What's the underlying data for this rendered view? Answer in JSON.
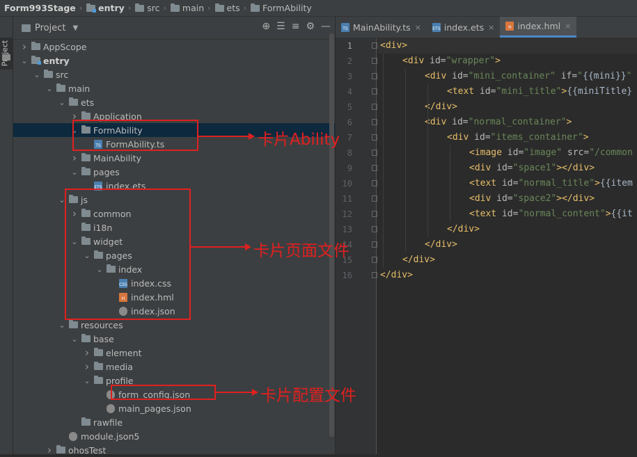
{
  "breadcrumb": [
    "Form993Stage",
    "entry",
    "src",
    "main",
    "ets",
    "FormAbility"
  ],
  "side_tab": "Project",
  "project_header": "Project",
  "tree": [
    {
      "label": "AppScope",
      "depth": 1,
      "arrow": "right",
      "icon": "folder"
    },
    {
      "label": "entry",
      "depth": 1,
      "arrow": "down",
      "icon": "module",
      "bold": true
    },
    {
      "label": "src",
      "depth": 2,
      "arrow": "down",
      "icon": "folder"
    },
    {
      "label": "main",
      "depth": 3,
      "arrow": "down",
      "icon": "folder"
    },
    {
      "label": "ets",
      "depth": 4,
      "arrow": "down",
      "icon": "folder"
    },
    {
      "label": "Application",
      "depth": 5,
      "arrow": "right",
      "icon": "folder"
    },
    {
      "label": "FormAbility",
      "depth": 5,
      "arrow": "down",
      "icon": "folder",
      "selected": true
    },
    {
      "label": "FormAbility.ts",
      "depth": 6,
      "arrow": "",
      "icon": "ts"
    },
    {
      "label": "MainAbility",
      "depth": 5,
      "arrow": "right",
      "icon": "folder"
    },
    {
      "label": "pages",
      "depth": 5,
      "arrow": "down",
      "icon": "folder"
    },
    {
      "label": "index.ets",
      "depth": 6,
      "arrow": "",
      "icon": "ets"
    },
    {
      "label": "js",
      "depth": 4,
      "arrow": "down",
      "icon": "folder"
    },
    {
      "label": "common",
      "depth": 5,
      "arrow": "right",
      "icon": "folder"
    },
    {
      "label": "i18n",
      "depth": 5,
      "arrow": "",
      "icon": "folder"
    },
    {
      "label": "widget",
      "depth": 5,
      "arrow": "down",
      "icon": "folder"
    },
    {
      "label": "pages",
      "depth": 6,
      "arrow": "down",
      "icon": "folder"
    },
    {
      "label": "index",
      "depth": 7,
      "arrow": "down",
      "icon": "folder"
    },
    {
      "label": "index.css",
      "depth": 8,
      "arrow": "",
      "icon": "css"
    },
    {
      "label": "index.hml",
      "depth": 8,
      "arrow": "",
      "icon": "hml"
    },
    {
      "label": "index.json",
      "depth": 8,
      "arrow": "",
      "icon": "json"
    },
    {
      "label": "resources",
      "depth": 4,
      "arrow": "down",
      "icon": "folder"
    },
    {
      "label": "base",
      "depth": 5,
      "arrow": "down",
      "icon": "folder"
    },
    {
      "label": "element",
      "depth": 6,
      "arrow": "right",
      "icon": "folder"
    },
    {
      "label": "media",
      "depth": 6,
      "arrow": "right",
      "icon": "folder"
    },
    {
      "label": "profile",
      "depth": 6,
      "arrow": "down",
      "icon": "folder"
    },
    {
      "label": "form_config.json",
      "depth": 7,
      "arrow": "",
      "icon": "json"
    },
    {
      "label": "main_pages.json",
      "depth": 7,
      "arrow": "",
      "icon": "json"
    },
    {
      "label": "rawfile",
      "depth": 5,
      "arrow": "",
      "icon": "folder"
    },
    {
      "label": "module.json5",
      "depth": 4,
      "arrow": "",
      "icon": "json5"
    },
    {
      "label": "ohosTest",
      "depth": 3,
      "arrow": "right",
      "icon": "folder"
    }
  ],
  "tabs": [
    {
      "label": "MainAbility.ts",
      "icon": "ts",
      "active": false
    },
    {
      "label": "index.ets",
      "icon": "ets",
      "active": false
    },
    {
      "label": "index.hml",
      "icon": "hml",
      "active": true
    }
  ],
  "code_lines": [
    {
      "indent": 0,
      "parts": [
        [
          "tag",
          "<div>"
        ]
      ]
    },
    {
      "indent": 1,
      "parts": [
        [
          "tag",
          "<div "
        ],
        [
          "attr",
          "id="
        ],
        [
          "val",
          "\"wrapper\""
        ],
        [
          "tag",
          ">"
        ]
      ]
    },
    {
      "indent": 2,
      "parts": [
        [
          "tag",
          "<div "
        ],
        [
          "attr",
          "id="
        ],
        [
          "val",
          "\"mini_container\" "
        ],
        [
          "attr",
          "if="
        ],
        [
          "val",
          "\""
        ],
        [
          "mus",
          "{{mini}}"
        ],
        [
          "val",
          "\""
        ]
      ]
    },
    {
      "indent": 3,
      "parts": [
        [
          "tag",
          "<text "
        ],
        [
          "attr",
          "id="
        ],
        [
          "val",
          "\"mini_title\""
        ],
        [
          "tag",
          ">"
        ],
        [
          "mus",
          "{{miniTitle}"
        ]
      ]
    },
    {
      "indent": 2,
      "parts": [
        [
          "tag",
          "</div>"
        ]
      ]
    },
    {
      "indent": 2,
      "parts": [
        [
          "tag",
          "<div "
        ],
        [
          "attr",
          "id="
        ],
        [
          "val",
          "\"normal_container\""
        ],
        [
          "tag",
          ">"
        ]
      ]
    },
    {
      "indent": 3,
      "parts": [
        [
          "tag",
          "<div "
        ],
        [
          "attr",
          "id="
        ],
        [
          "val",
          "\"items_container\""
        ],
        [
          "tag",
          ">"
        ]
      ]
    },
    {
      "indent": 4,
      "parts": [
        [
          "tag",
          "<image "
        ],
        [
          "attr",
          "id="
        ],
        [
          "val",
          "\"image\" "
        ],
        [
          "attr",
          "src="
        ],
        [
          "val",
          "\"/common"
        ]
      ]
    },
    {
      "indent": 4,
      "parts": [
        [
          "tag",
          "<div "
        ],
        [
          "attr",
          "id="
        ],
        [
          "val",
          "\"space1\""
        ],
        [
          "tag",
          "></div>"
        ]
      ]
    },
    {
      "indent": 4,
      "parts": [
        [
          "tag",
          "<text "
        ],
        [
          "attr",
          "id="
        ],
        [
          "val",
          "\"normal_title\""
        ],
        [
          "tag",
          ">"
        ],
        [
          "mus",
          "{{item"
        ]
      ]
    },
    {
      "indent": 4,
      "parts": [
        [
          "tag",
          "<div "
        ],
        [
          "attr",
          "id="
        ],
        [
          "val",
          "\"space2\""
        ],
        [
          "tag",
          "></div>"
        ]
      ]
    },
    {
      "indent": 4,
      "parts": [
        [
          "tag",
          "<text "
        ],
        [
          "attr",
          "id="
        ],
        [
          "val",
          "\"normal_content\""
        ],
        [
          "tag",
          ">"
        ],
        [
          "mus",
          "{{it"
        ]
      ]
    },
    {
      "indent": 3,
      "parts": [
        [
          "tag",
          "</div>"
        ]
      ]
    },
    {
      "indent": 2,
      "parts": [
        [
          "tag",
          "</div>"
        ]
      ]
    },
    {
      "indent": 1,
      "parts": [
        [
          "tag",
          "</div>"
        ]
      ]
    },
    {
      "indent": 0,
      "parts": [
        [
          "tag",
          "</div>"
        ]
      ]
    }
  ],
  "annotations": {
    "ability": "卡片Ability",
    "page_files": "卡片页面文件",
    "config_file": "卡片配置文件"
  }
}
